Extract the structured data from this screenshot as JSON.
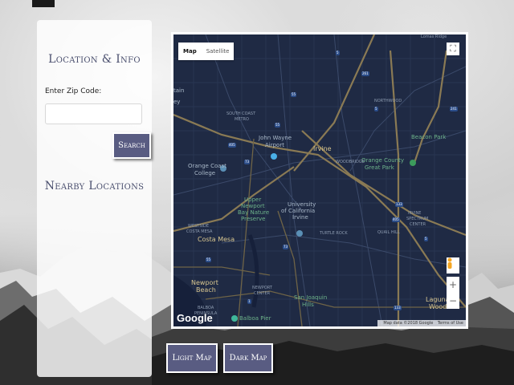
{
  "sidebar": {
    "title": "Location & Info",
    "zip_label": "Enter Zip Code:",
    "zip_value": "",
    "search_label": "Search",
    "nearby_title": "Nearby Locations"
  },
  "map": {
    "type_map": "Map",
    "type_satellite": "Satellite",
    "logo": "Google",
    "attribution": "Map data ©2018 Google",
    "terms": "Terms of Use",
    "labels": {
      "irvine": "Irvine",
      "john_wayne_1": "John Wayne",
      "john_wayne_2": "Airport",
      "occ_1": "Orange Coast",
      "occ_2": "College",
      "uci_1": "University",
      "uci_2": "of California",
      "uci_3": "Irvine",
      "upper_1": "Upper",
      "upper_2": "Newport",
      "upper_3": "Bay Nature",
      "upper_4": "Preserve",
      "costa_mesa": "Costa Mesa",
      "newport_1": "Newport",
      "newport_2": "Beach",
      "san_joaquin_1": "San Joaquin",
      "san_joaquin_2": "Hills",
      "beacon_park": "Beacon Park",
      "great_park_1": "Orange County",
      "great_park_2": "Great Park",
      "laguna_1": "Laguna",
      "laguna_2": "Woods",
      "balboa": "Balboa Pier",
      "tain": "tain",
      "ey": "ey",
      "south_coast": "SOUTH COAST",
      "metro": "METRO",
      "northwood": "NORTHWOOD",
      "woodbridge": "WOODBRIDGE",
      "turtle_rock": "TURTLE ROCK",
      "quail_hill": "QUAIL HILL",
      "westside_1": "WESTSIDE",
      "westside_2": "COSTA MESA",
      "newport_center_1": "NEWPORT",
      "newport_center_2": "CENTER",
      "balboa_peninsula_1": "BALBOA",
      "balboa_peninsula_2": "PENINSULA",
      "irvine_spectrum_1": "IRVINE",
      "irvine_spectrum_2": "SPECTRUM",
      "irvine_spectrum_3": "CENTER",
      "lomas": "Lomas Ridge"
    },
    "shields": [
      "5",
      "261",
      "5",
      "55",
      "241",
      "405",
      "73",
      "55",
      "133",
      "405",
      "5",
      "73",
      "55",
      "133",
      "1"
    ]
  },
  "buttons": {
    "light_map": "Light Map",
    "dark_map": "Dark Map"
  }
}
